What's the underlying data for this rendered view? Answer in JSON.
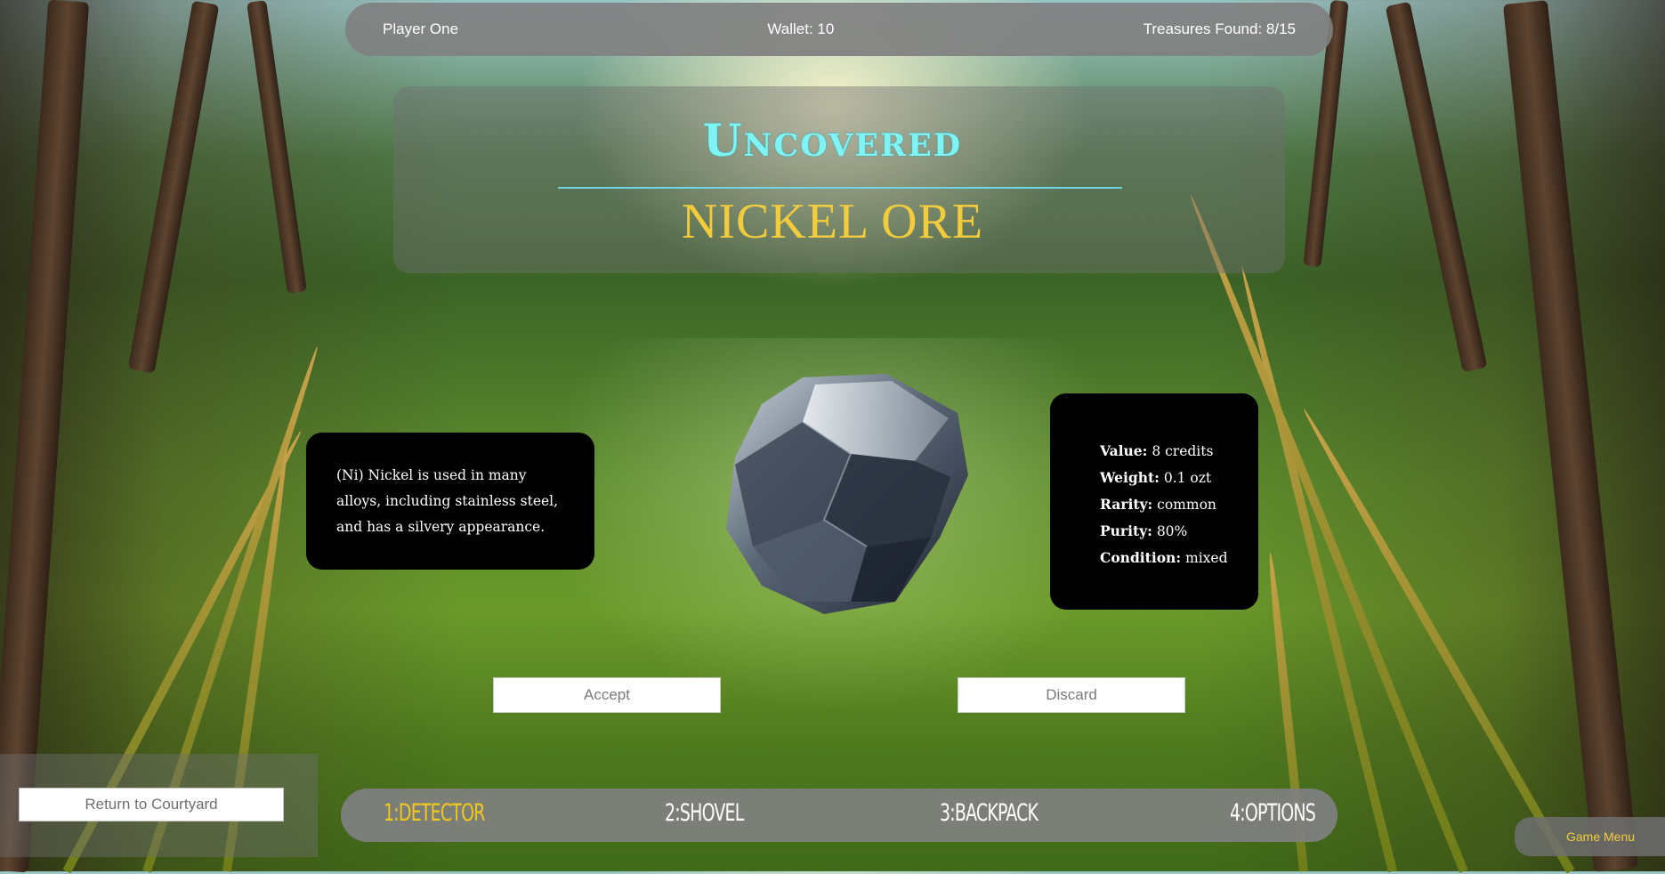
{
  "status_bar": {
    "player": "Player One",
    "wallet": "Wallet: 10",
    "treasures": "Treasures Found: 8/15"
  },
  "find": {
    "heading": "Uncovered",
    "item_name": "NICKEL ORE",
    "description": "(Ni) Nickel is used in many alloys, including stainless steel, and has a silvery appearance."
  },
  "stats": [
    {
      "label": "Value:",
      "value": "8 credits"
    },
    {
      "label": "Weight:",
      "value": "0.1 ozt"
    },
    {
      "label": "Rarity:",
      "value": "common"
    },
    {
      "label": "Purity:",
      "value": "80%"
    },
    {
      "label": "Condition:",
      "value": "mixed"
    }
  ],
  "actions": {
    "accept": "Accept",
    "discard": "Discard",
    "return": "Return to Courtyard"
  },
  "tools": [
    {
      "label": "1:DETECTOR",
      "active": true
    },
    {
      "label": "2:SHOVEL",
      "active": false
    },
    {
      "label": "3:BACKPACK",
      "active": false
    },
    {
      "label": "4:OPTIONS",
      "active": false
    }
  ],
  "game_menu": "Game Menu",
  "colors": {
    "heading": "#7ff4f4",
    "item_name": "#f2cc3c",
    "active_tool": "#f2c81c",
    "panel": "#000000",
    "bar": "#808080"
  },
  "icons": {
    "treasure": "nickel-ore-rock"
  }
}
